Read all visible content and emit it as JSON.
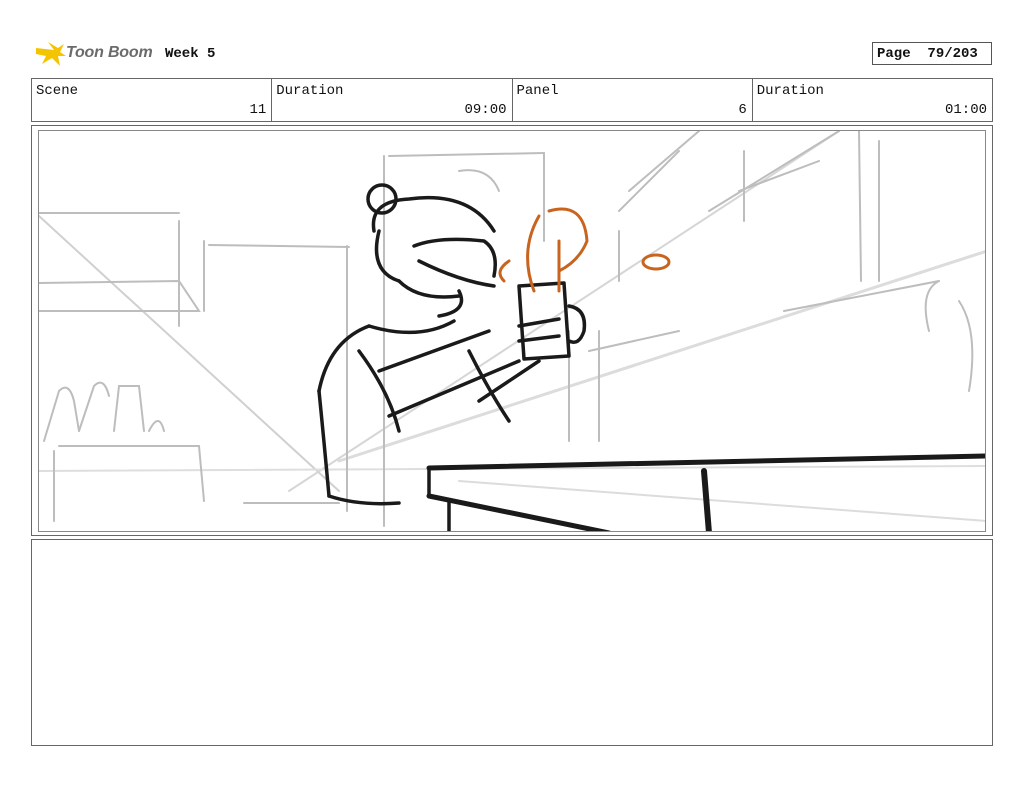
{
  "header": {
    "logo_text": "Toon Boom",
    "project": "Week 5",
    "page_label": "Page",
    "page_value": "79/203"
  },
  "info": {
    "scene_label": "Scene",
    "scene_value": "11",
    "scene_duration_label": "Duration",
    "scene_duration_value": "09:00",
    "panel_label": "Panel",
    "panel_value": "6",
    "panel_duration_label": "Duration",
    "panel_duration_value": "01:00"
  },
  "colors": {
    "sketch": "#1a1a1a",
    "background_lines": "#b8b8b8",
    "steam": "#c8641e",
    "logo_star": "#f5c400"
  },
  "notes": {
    "text": ""
  }
}
